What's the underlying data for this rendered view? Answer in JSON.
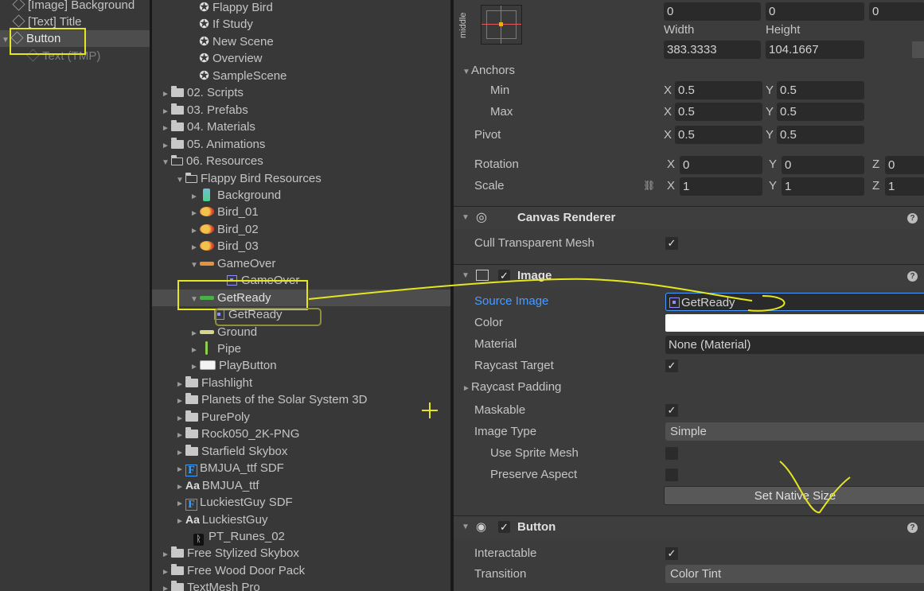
{
  "hierarchy": {
    "items": [
      {
        "label": "[Image] Background",
        "state": "normal"
      },
      {
        "label": "[Text] Title",
        "state": "normal"
      },
      {
        "label": "Button",
        "state": "selected"
      },
      {
        "label": "Text (TMP)",
        "state": "disabled"
      }
    ]
  },
  "project": {
    "items": [
      {
        "label": "Flappy Bird",
        "type": "scene"
      },
      {
        "label": "If Study",
        "type": "scene"
      },
      {
        "label": "New Scene",
        "type": "scene"
      },
      {
        "label": "Overview",
        "type": "scene"
      },
      {
        "label": "SampleScene",
        "type": "scene"
      },
      {
        "label": "02. Scripts",
        "type": "folder"
      },
      {
        "label": "03. Prefabs",
        "type": "folder"
      },
      {
        "label": "04. Materials",
        "type": "folder"
      },
      {
        "label": "05. Animations",
        "type": "folder"
      },
      {
        "label": "06. Resources",
        "type": "folder-open"
      },
      {
        "label": "Flappy Bird Resources",
        "type": "folder-open"
      },
      {
        "label": "Background",
        "type": "texture-bg"
      },
      {
        "label": "Bird_01",
        "type": "texture-bird"
      },
      {
        "label": "Bird_02",
        "type": "texture-bird"
      },
      {
        "label": "Bird_03",
        "type": "texture-bird"
      },
      {
        "label": "GameOver",
        "type": "texture-gameover"
      },
      {
        "label": "GameOver",
        "type": "sprite"
      },
      {
        "label": "GetReady",
        "type": "texture-getready"
      },
      {
        "label": "GetReady",
        "type": "sprite"
      },
      {
        "label": "Ground",
        "type": "texture-ground"
      },
      {
        "label": "Pipe",
        "type": "texture-pipe"
      },
      {
        "label": "PlayButton",
        "type": "texture-play"
      },
      {
        "label": "Flashlight",
        "type": "folder"
      },
      {
        "label": "Planets of the Solar System 3D",
        "type": "folder"
      },
      {
        "label": "PurePoly",
        "type": "folder"
      },
      {
        "label": "Rock050_2K-PNG",
        "type": "folder"
      },
      {
        "label": "Starfield Skybox",
        "type": "folder"
      },
      {
        "label": "BMJUA_ttf SDF",
        "type": "font-sdf"
      },
      {
        "label": "BMJUA_ttf",
        "type": "font"
      },
      {
        "label": "LuckiestGuy SDF",
        "type": "font-sdf"
      },
      {
        "label": "LuckiestGuy",
        "type": "font"
      },
      {
        "label": "PT_Runes_02",
        "type": "rune"
      },
      {
        "label": "Free Stylized Skybox",
        "type": "folder"
      },
      {
        "label": "Free Wood Door Pack",
        "type": "folder"
      },
      {
        "label": "TextMesh Pro",
        "type": "folder"
      }
    ]
  },
  "inspector": {
    "rect": {
      "anchor_preset_label": "middle",
      "pos": [
        "0",
        "0",
        "0"
      ],
      "width_label": "Width",
      "height_label": "Height",
      "width_value": "383.3333",
      "height_value": "104.1667",
      "anchors_label": "Anchors",
      "min_label": "Min",
      "max_label": "Max",
      "pivot_label": "Pivot",
      "rotation_label": "Rotation",
      "scale_label": "Scale",
      "x_axis": "X",
      "y_axis": "Y",
      "z_axis": "Z",
      "min": [
        "0.5",
        "0.5"
      ],
      "max": [
        "0.5",
        "0.5"
      ],
      "pivot": [
        "0.5",
        "0.5"
      ],
      "rotation": [
        "0",
        "0",
        "0"
      ],
      "scale": [
        "1",
        "1",
        "1"
      ]
    },
    "canvas_renderer": {
      "title": "Canvas Renderer",
      "cull_label": "Cull Transparent Mesh",
      "cull_checked": true
    },
    "image": {
      "title": "Image",
      "enabled": true,
      "source_image_label": "Source Image",
      "source_image_value": "GetReady",
      "color_label": "Color",
      "color_value": "#ffffff",
      "material_label": "Material",
      "material_value": "None (Material)",
      "raycast_target_label": "Raycast Target",
      "raycast_target_checked": true,
      "raycast_padding_label": "Raycast Padding",
      "maskable_label": "Maskable",
      "maskable_checked": true,
      "image_type_label": "Image Type",
      "image_type_value": "Simple",
      "use_sprite_mesh_label": "Use Sprite Mesh",
      "use_sprite_mesh_checked": false,
      "preserve_aspect_label": "Preserve Aspect",
      "preserve_aspect_checked": false,
      "set_native_size_label": "Set Native Size"
    },
    "button": {
      "title": "Button",
      "enabled": true,
      "interactable_label": "Interactable",
      "interactable_checked": true,
      "transition_label": "Transition",
      "transition_value": "Color Tint"
    },
    "help_glyph": "?",
    "check_glyph": "✓"
  },
  "annotation_color": "#e6e61e"
}
